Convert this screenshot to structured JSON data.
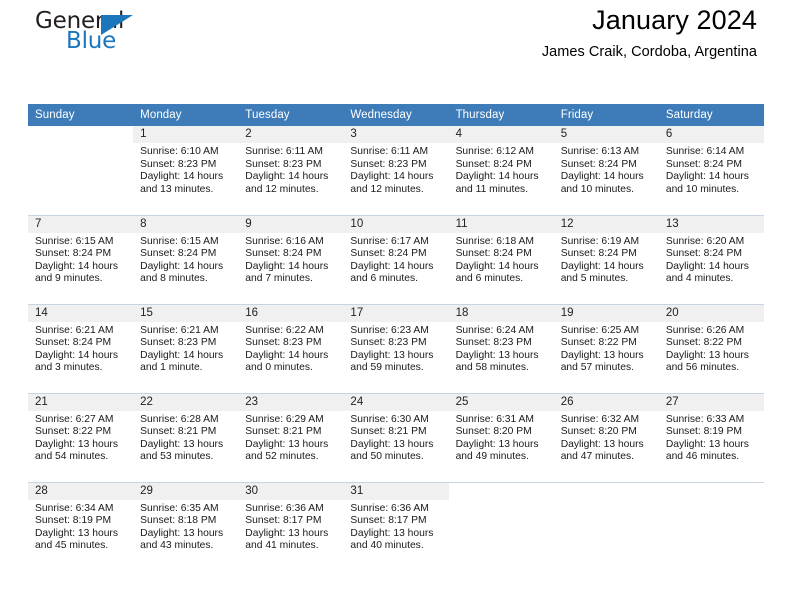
{
  "logo": {
    "word_one": "General",
    "word_two": "Blue",
    "triangle_color": "#1b76bc",
    "text_color": "#231f20"
  },
  "header": {
    "title": "January 2024",
    "subtitle": "James Craik, Cordoba, Argentina",
    "header_bg": "#3e7cb9",
    "daynum_bg": "#f0f0f0"
  },
  "weekdays": [
    "Sunday",
    "Monday",
    "Tuesday",
    "Wednesday",
    "Thursday",
    "Friday",
    "Saturday"
  ],
  "labels": {
    "sunrise": "Sunrise:",
    "sunset": "Sunset:",
    "daylight": "Daylight:"
  },
  "weeks": [
    [
      {
        "day": "",
        "sunrise": "",
        "sunset": "",
        "daylight": "",
        "empty": true
      },
      {
        "day": "1",
        "sunrise": "Sunrise: 6:10 AM",
        "sunset": "Sunset: 8:23 PM",
        "daylight": "Daylight: 14 hours and 13 minutes."
      },
      {
        "day": "2",
        "sunrise": "Sunrise: 6:11 AM",
        "sunset": "Sunset: 8:23 PM",
        "daylight": "Daylight: 14 hours and 12 minutes."
      },
      {
        "day": "3",
        "sunrise": "Sunrise: 6:11 AM",
        "sunset": "Sunset: 8:23 PM",
        "daylight": "Daylight: 14 hours and 12 minutes."
      },
      {
        "day": "4",
        "sunrise": "Sunrise: 6:12 AM",
        "sunset": "Sunset: 8:24 PM",
        "daylight": "Daylight: 14 hours and 11 minutes."
      },
      {
        "day": "5",
        "sunrise": "Sunrise: 6:13 AM",
        "sunset": "Sunset: 8:24 PM",
        "daylight": "Daylight: 14 hours and 10 minutes."
      },
      {
        "day": "6",
        "sunrise": "Sunrise: 6:14 AM",
        "sunset": "Sunset: 8:24 PM",
        "daylight": "Daylight: 14 hours and 10 minutes."
      }
    ],
    [
      {
        "day": "7",
        "sunrise": "Sunrise: 6:15 AM",
        "sunset": "Sunset: 8:24 PM",
        "daylight": "Daylight: 14 hours and 9 minutes."
      },
      {
        "day": "8",
        "sunrise": "Sunrise: 6:15 AM",
        "sunset": "Sunset: 8:24 PM",
        "daylight": "Daylight: 14 hours and 8 minutes."
      },
      {
        "day": "9",
        "sunrise": "Sunrise: 6:16 AM",
        "sunset": "Sunset: 8:24 PM",
        "daylight": "Daylight: 14 hours and 7 minutes."
      },
      {
        "day": "10",
        "sunrise": "Sunrise: 6:17 AM",
        "sunset": "Sunset: 8:24 PM",
        "daylight": "Daylight: 14 hours and 6 minutes."
      },
      {
        "day": "11",
        "sunrise": "Sunrise: 6:18 AM",
        "sunset": "Sunset: 8:24 PM",
        "daylight": "Daylight: 14 hours and 6 minutes."
      },
      {
        "day": "12",
        "sunrise": "Sunrise: 6:19 AM",
        "sunset": "Sunset: 8:24 PM",
        "daylight": "Daylight: 14 hours and 5 minutes."
      },
      {
        "day": "13",
        "sunrise": "Sunrise: 6:20 AM",
        "sunset": "Sunset: 8:24 PM",
        "daylight": "Daylight: 14 hours and 4 minutes."
      }
    ],
    [
      {
        "day": "14",
        "sunrise": "Sunrise: 6:21 AM",
        "sunset": "Sunset: 8:24 PM",
        "daylight": "Daylight: 14 hours and 3 minutes."
      },
      {
        "day": "15",
        "sunrise": "Sunrise: 6:21 AM",
        "sunset": "Sunset: 8:23 PM",
        "daylight": "Daylight: 14 hours and 1 minute."
      },
      {
        "day": "16",
        "sunrise": "Sunrise: 6:22 AM",
        "sunset": "Sunset: 8:23 PM",
        "daylight": "Daylight: 14 hours and 0 minutes."
      },
      {
        "day": "17",
        "sunrise": "Sunrise: 6:23 AM",
        "sunset": "Sunset: 8:23 PM",
        "daylight": "Daylight: 13 hours and 59 minutes."
      },
      {
        "day": "18",
        "sunrise": "Sunrise: 6:24 AM",
        "sunset": "Sunset: 8:23 PM",
        "daylight": "Daylight: 13 hours and 58 minutes."
      },
      {
        "day": "19",
        "sunrise": "Sunrise: 6:25 AM",
        "sunset": "Sunset: 8:22 PM",
        "daylight": "Daylight: 13 hours and 57 minutes."
      },
      {
        "day": "20",
        "sunrise": "Sunrise: 6:26 AM",
        "sunset": "Sunset: 8:22 PM",
        "daylight": "Daylight: 13 hours and 56 minutes."
      }
    ],
    [
      {
        "day": "21",
        "sunrise": "Sunrise: 6:27 AM",
        "sunset": "Sunset: 8:22 PM",
        "daylight": "Daylight: 13 hours and 54 minutes."
      },
      {
        "day": "22",
        "sunrise": "Sunrise: 6:28 AM",
        "sunset": "Sunset: 8:21 PM",
        "daylight": "Daylight: 13 hours and 53 minutes."
      },
      {
        "day": "23",
        "sunrise": "Sunrise: 6:29 AM",
        "sunset": "Sunset: 8:21 PM",
        "daylight": "Daylight: 13 hours and 52 minutes."
      },
      {
        "day": "24",
        "sunrise": "Sunrise: 6:30 AM",
        "sunset": "Sunset: 8:21 PM",
        "daylight": "Daylight: 13 hours and 50 minutes."
      },
      {
        "day": "25",
        "sunrise": "Sunrise: 6:31 AM",
        "sunset": "Sunset: 8:20 PM",
        "daylight": "Daylight: 13 hours and 49 minutes."
      },
      {
        "day": "26",
        "sunrise": "Sunrise: 6:32 AM",
        "sunset": "Sunset: 8:20 PM",
        "daylight": "Daylight: 13 hours and 47 minutes."
      },
      {
        "day": "27",
        "sunrise": "Sunrise: 6:33 AM",
        "sunset": "Sunset: 8:19 PM",
        "daylight": "Daylight: 13 hours and 46 minutes."
      }
    ],
    [
      {
        "day": "28",
        "sunrise": "Sunrise: 6:34 AM",
        "sunset": "Sunset: 8:19 PM",
        "daylight": "Daylight: 13 hours and 45 minutes."
      },
      {
        "day": "29",
        "sunrise": "Sunrise: 6:35 AM",
        "sunset": "Sunset: 8:18 PM",
        "daylight": "Daylight: 13 hours and 43 minutes."
      },
      {
        "day": "30",
        "sunrise": "Sunrise: 6:36 AM",
        "sunset": "Sunset: 8:17 PM",
        "daylight": "Daylight: 13 hours and 41 minutes."
      },
      {
        "day": "31",
        "sunrise": "Sunrise: 6:36 AM",
        "sunset": "Sunset: 8:17 PM",
        "daylight": "Daylight: 13 hours and 40 minutes."
      },
      {
        "day": "",
        "sunrise": "",
        "sunset": "",
        "daylight": "",
        "empty": true
      },
      {
        "day": "",
        "sunrise": "",
        "sunset": "",
        "daylight": "",
        "empty": true
      },
      {
        "day": "",
        "sunrise": "",
        "sunset": "",
        "daylight": "",
        "empty": true
      }
    ]
  ]
}
